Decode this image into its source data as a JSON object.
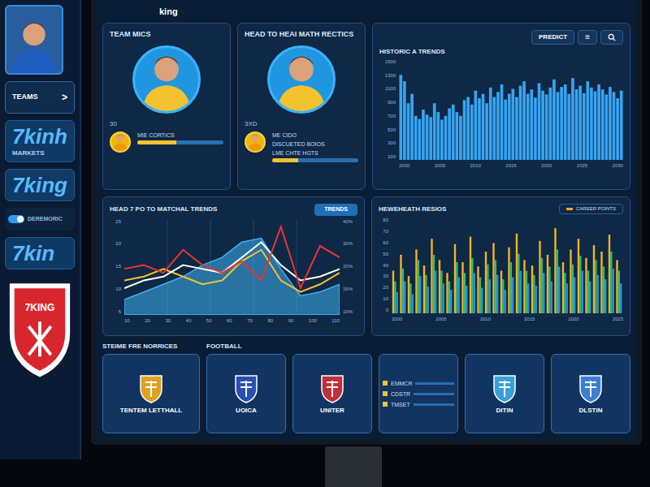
{
  "window": {
    "title": "king"
  },
  "sidebar": {
    "items": [
      {
        "kind": "nav",
        "label": "TEAMS",
        "icon": ">"
      },
      {
        "kind": "logo",
        "label": "7kinh",
        "sub": "MARKETS"
      },
      {
        "kind": "logo",
        "label": "7king"
      },
      {
        "kind": "toggle",
        "label": "DEREMORIC",
        "on": true
      },
      {
        "kind": "logo",
        "label": "7kin"
      },
      {
        "kind": "shield",
        "label": "7KING"
      }
    ]
  },
  "toolbar": {
    "filter": "PREDICT",
    "menu": "≡"
  },
  "player_cards": [
    {
      "title": "TEAM MICS",
      "number": "30",
      "details": [
        "MIE CORTICS"
      ],
      "level": 0.45
    },
    {
      "title": "HEAD TO HEAI MATH RECTICS",
      "number": "3XD",
      "details": [
        "ME CIDO",
        "DISCUETED BOIOS",
        "LME CHTE HGTS"
      ],
      "level": 0.3
    }
  ],
  "historic_chart": {
    "title": "HISTORIC A TRENDS",
    "max": 1600,
    "y_ticks": [
      "1500",
      "1300",
      "1100",
      "900",
      "700",
      "500",
      "300",
      "100"
    ],
    "x_ticks": [
      "2000",
      "2005",
      "2010",
      "2015",
      "2020",
      "2025",
      "2030"
    ],
    "values": [
      1350,
      1250,
      900,
      1050,
      700,
      650,
      800,
      720,
      680,
      900,
      760,
      640,
      700,
      820,
      880,
      760,
      700,
      950,
      1000,
      880,
      1100,
      980,
      1050,
      900,
      1150,
      1000,
      1080,
      1200,
      960,
      1050,
      1130,
      1000,
      1180,
      1250,
      1050,
      1120,
      990,
      1220,
      1100,
      1040,
      1150,
      1280,
      1080,
      1160,
      1200,
      1050,
      1300,
      1120,
      1180,
      1060,
      1250,
      1150,
      1090,
      1200,
      1120,
      1040,
      1160,
      1080,
      980,
      1100
    ]
  },
  "trend_chart": {
    "title": "HEAD 7 PO TO MATCHAL TRENDS",
    "button": "TRENDS",
    "max": 25,
    "y_ticks_left": [
      "25",
      "20",
      "15",
      "10",
      "5"
    ],
    "y_ticks_right": [
      "40%",
      "30%",
      "20%",
      "15%",
      "10%"
    ],
    "x_ticks": [
      "10",
      "20",
      "30",
      "40",
      "50",
      "60",
      "70",
      "80",
      "90",
      "100",
      "110"
    ],
    "series": [
      {
        "kind": "area",
        "color": "#3fb0f0",
        "values": [
          4,
          6,
          8,
          10,
          13,
          15,
          19,
          20,
          12,
          5,
          6,
          8
        ]
      },
      {
        "kind": "line",
        "color": "#f2c230",
        "values": [
          9,
          10,
          12,
          10,
          8,
          9,
          14,
          17,
          9,
          6,
          8,
          11
        ]
      },
      {
        "kind": "line",
        "color": "#ffffff",
        "values": [
          7,
          9,
          10,
          13,
          12,
          11,
          15,
          19,
          13,
          9,
          10,
          12
        ]
      },
      {
        "kind": "line",
        "color": "#e8342f",
        "values": [
          12,
          13,
          11,
          17,
          13,
          11,
          14,
          9,
          23,
          7,
          18,
          15
        ]
      }
    ]
  },
  "ratio_chart": {
    "title": "HEWEHEATH RESIOS",
    "max": 90,
    "legend": [
      {
        "label": "CAREER POINTS",
        "color": "#f5a623"
      }
    ],
    "y_ticks": [
      "80",
      "70",
      "60",
      "50",
      "40",
      "30",
      "20",
      "10",
      "0"
    ],
    "x_ticks": [
      "2000",
      "2005",
      "2010",
      "2015",
      "2020",
      "2025"
    ],
    "series": [
      {
        "color": "#f5b323",
        "values": [
          40,
          55,
          35,
          60,
          45,
          70,
          50,
          38,
          65,
          48,
          72,
          44,
          58,
          66,
          40,
          62,
          75,
          50,
          45,
          68,
          55,
          80,
          48,
          60,
          70,
          52,
          64,
          58,
          74,
          50
        ]
      },
      {
        "color": "#2fbf71",
        "values": [
          30,
          42,
          28,
          50,
          36,
          55,
          40,
          30,
          48,
          38,
          52,
          34,
          46,
          50,
          32,
          48,
          56,
          40,
          36,
          52,
          44,
          60,
          38,
          46,
          54,
          40,
          50,
          44,
          58,
          40
        ]
      },
      {
        "color": "#2f8fe0",
        "values": [
          20,
          30,
          18,
          35,
          25,
          40,
          28,
          22,
          34,
          26,
          38,
          24,
          32,
          36,
          22,
          34,
          40,
          28,
          26,
          38,
          30,
          44,
          28,
          34,
          40,
          30,
          36,
          32,
          42,
          28
        ]
      }
    ]
  },
  "bottom_groups": [
    {
      "title": "STEIME FRE NORRICES",
      "cards": [
        {
          "kind": "badge",
          "label": "TENTEM LETTHALL",
          "color": "#e0a020"
        }
      ]
    },
    {
      "title": "FOOTBALL",
      "cards": [
        {
          "kind": "badge",
          "label": "UOICA",
          "color": "#2a4fb0"
        },
        {
          "kind": "badge",
          "label": "UNITER",
          "color": "#c0303a"
        },
        {
          "kind": "list",
          "rows": [
            "EMMCR",
            "CDSTR",
            "TMSET"
          ]
        },
        {
          "kind": "badge",
          "label": "DITIN",
          "color": "#3aa0d8"
        },
        {
          "kind": "badge",
          "label": "DLSTIN",
          "color": "#3a7fd0"
        }
      ]
    }
  ]
}
